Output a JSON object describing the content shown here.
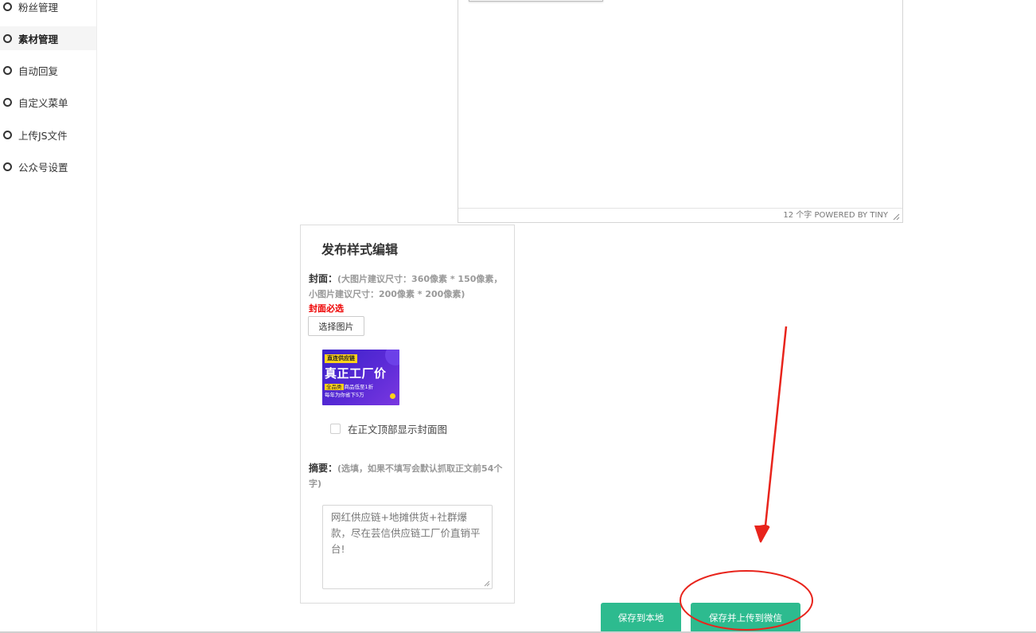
{
  "sidebar": {
    "items": [
      {
        "label": "粉丝管理"
      },
      {
        "label": "素材管理"
      },
      {
        "label": "自动回复"
      },
      {
        "label": "自定义菜单"
      },
      {
        "label": "上传JS文件"
      },
      {
        "label": "公众号设置"
      }
    ],
    "active_label": "素材管理"
  },
  "editor": {
    "status_text": "12 个字  POWERED BY TINY"
  },
  "publish_panel": {
    "title": "发布样式编辑",
    "cover_key": "封面：",
    "cover_hint": "(大图片建议尺寸：360像素 * 150像素，小图片建议尺寸：200像素 * 200像素)",
    "cover_required": "封面必选",
    "choose_image_button": "选择图片",
    "cover_image": {
      "badge": "直连供应链",
      "headline": "真正工厂价",
      "line1_tag": "全品类",
      "line1": "商品低至1折",
      "line2": "每年为你省下5万"
    },
    "show_cover_label": "在正文顶部显示封面图",
    "show_cover_checked": false,
    "summary_key": "摘要：",
    "summary_hint": "(选填，如果不填写会默认抓取正文前54个字)",
    "summary_value": "网红供应链+地摊供货+社群爆款，尽在芸信供应链工厂价直销平台!"
  },
  "actions": {
    "save_local": "保存到本地",
    "save_upload_wechat": "保存并上传到微信"
  },
  "colors": {
    "accent_green": "#2dbb8f",
    "annotation_red": "#e8241c",
    "required_red": "#ee0000"
  }
}
